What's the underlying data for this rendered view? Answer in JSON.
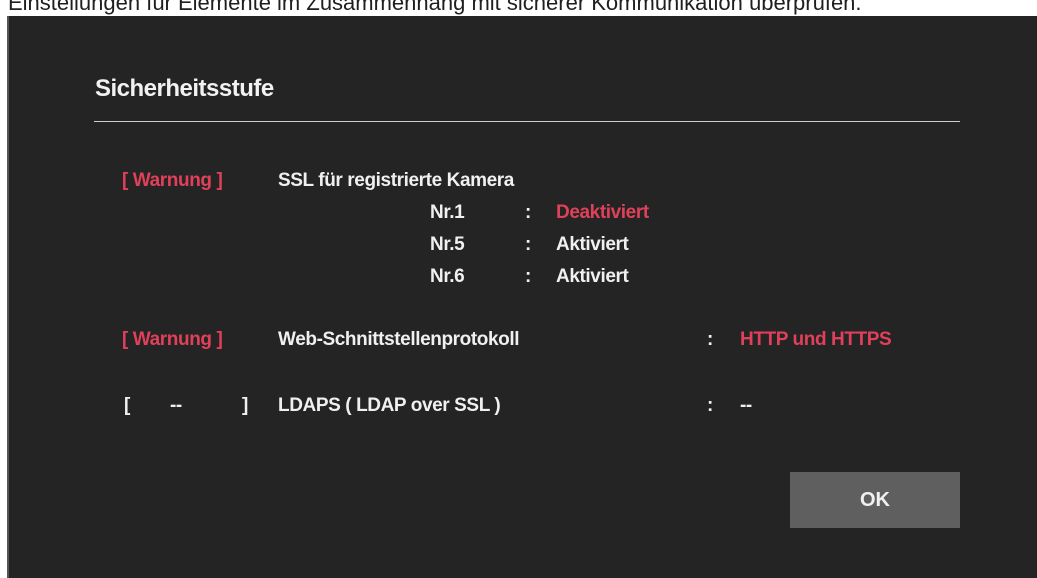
{
  "top_note": "Einstellungen für Elemente im Zusammenhang mit sicherer Kommunikation überprüfen.",
  "dialog": {
    "title": "Sicherheitsstufe",
    "rows": [
      {
        "tag": "[ Warnung ]",
        "label": "SSL für registrierte Kamera",
        "cameras": [
          {
            "id": "Nr.1",
            "sep": ":",
            "value": "Deaktiviert"
          },
          {
            "id": "Nr.5",
            "sep": ":",
            "value": "Aktiviert"
          },
          {
            "id": "Nr.6",
            "sep": ":",
            "value": "Aktiviert"
          }
        ]
      },
      {
        "tag": "[ Warnung ]",
        "label": "Web-Schnittstellenprotokoll",
        "sep": ":",
        "value": "HTTP und HTTPS"
      },
      {
        "tag_open": "[",
        "tag_mid": "--",
        "tag_close": "]",
        "label": "LDAPS ( LDAP over SSL )",
        "sep": ":",
        "value": "--"
      }
    ],
    "ok_label": "OK"
  },
  "colors": {
    "background": "#242424",
    "warning": "#e0405a",
    "text": "#f0f0f0",
    "button": "#5f5f5f"
  }
}
